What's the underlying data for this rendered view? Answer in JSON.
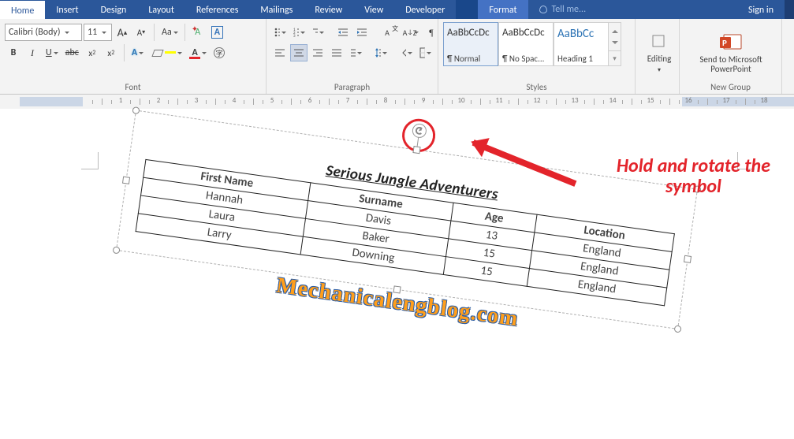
{
  "tabs": {
    "home": "Home",
    "insert": "Insert",
    "design": "Design",
    "layout": "Layout",
    "references": "References",
    "mailings": "Mailings",
    "review": "Review",
    "view": "View",
    "developer": "Developer",
    "format": "Format",
    "tell": "Tell me...",
    "signin": "Sign in"
  },
  "font": {
    "name": "Calibri (Body)",
    "size": "11",
    "group_label": "Font"
  },
  "paragraph": {
    "group_label": "Paragraph"
  },
  "styles": {
    "group_label": "Styles",
    "items": [
      {
        "preview": "AaBbCcDc",
        "name": "¶ Normal"
      },
      {
        "preview": "AaBbCcDc",
        "name": "¶ No Spac..."
      },
      {
        "preview": "AaBbCc",
        "name": "Heading 1"
      }
    ]
  },
  "editing": {
    "label": "Editing"
  },
  "newgroup": {
    "label": "Send to Microsoft PowerPoint",
    "group_label": "New Group"
  },
  "ruler_numbers": [
    1,
    2,
    3,
    4,
    5,
    6,
    7,
    8,
    9,
    10,
    11,
    12,
    13,
    14,
    15,
    16,
    17,
    18
  ],
  "content": {
    "title": "Serious Jungle Adventurers",
    "headers": [
      "First Name",
      "Surname",
      "Age",
      "Location"
    ],
    "rows": [
      [
        "Hannah",
        "Davis",
        "13",
        "England"
      ],
      [
        "Laura",
        "Baker",
        "15",
        "England"
      ],
      [
        "Larry",
        "Downing",
        "15",
        "England"
      ]
    ]
  },
  "watermark": "Mechanicalengblog.com",
  "annotation": {
    "line1": "Hold and rotate the",
    "line2": "symbol"
  }
}
